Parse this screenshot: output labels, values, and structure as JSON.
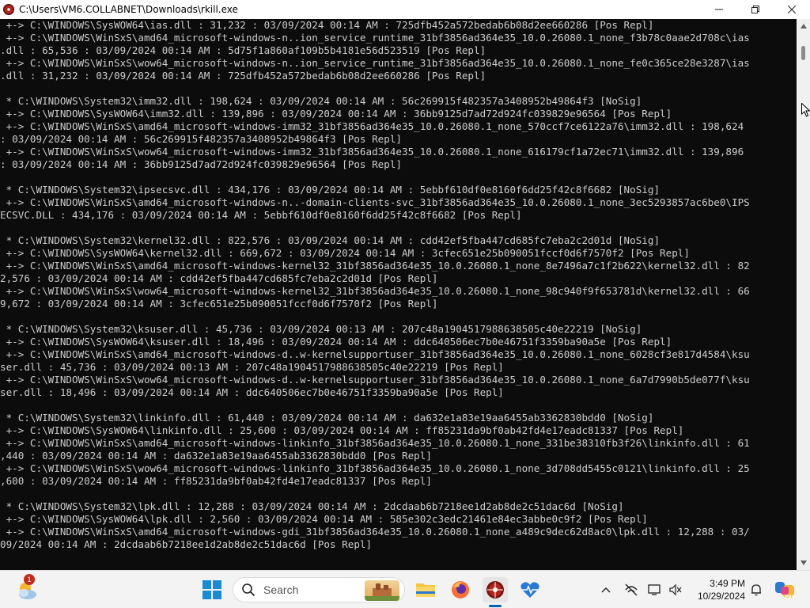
{
  "window": {
    "title": "C:\\Users\\VM6.COLLABNET\\Downloads\\rkill.exe"
  },
  "console": {
    "lines": [
      " +-> C:\\WINDOWS\\SysWOW64\\ias.dll : 31,232 : 03/09/2024 00:14 AM : 725dfb452a572bedab6b08d2ee660286 [Pos Repl]",
      " +-> C:\\WINDOWS\\WinSxS\\amd64_microsoft-windows-n..ion_service_runtime_31bf3856ad364e35_10.0.26080.1_none_f3b78c0aae2d708c\\ias",
      ".dll : 65,536 : 03/09/2024 00:14 AM : 5d75f1a860af109b5b4181e56d523519 [Pos Repl]",
      " +-> C:\\WINDOWS\\WinSxS\\wow64_microsoft-windows-n..ion_service_runtime_31bf3856ad364e35_10.0.26080.1_none_fe0c365ce28e3287\\ias",
      ".dll : 31,232 : 03/09/2024 00:14 AM : 725dfb452a572bedab6b08d2ee660286 [Pos Repl]",
      "",
      " * C:\\WINDOWS\\System32\\imm32.dll : 198,624 : 03/09/2024 00:14 AM : 56c269915f482357a3408952b49864f3 [NoSig]",
      " +-> C:\\WINDOWS\\SysWOW64\\imm32.dll : 139,896 : 03/09/2024 00:14 AM : 36bb9125d7ad72d924fc039829e96564 [Pos Repl]",
      " +-> C:\\WINDOWS\\WinSxS\\amd64_microsoft-windows-imm32_31bf3856ad364e35_10.0.26080.1_none_570ccf7ce6122a76\\imm32.dll : 198,624",
      ": 03/09/2024 00:14 AM : 56c269915f482357a3408952b49864f3 [Pos Repl]",
      " +-> C:\\WINDOWS\\WinSxS\\wow64_microsoft-windows-imm32_31bf3856ad364e35_10.0.26080.1_none_616179cf1a72ec71\\imm32.dll : 139,896",
      ": 03/09/2024 00:14 AM : 36bb9125d7ad72d924fc039829e96564 [Pos Repl]",
      "",
      " * C:\\WINDOWS\\System32\\ipsecsvc.dll : 434,176 : 03/09/2024 00:14 AM : 5ebbf610df0e8160f6dd25f42c8f6682 [NoSig]",
      " +-> C:\\WINDOWS\\WinSxS\\amd64_microsoft-windows-n..-domain-clients-svc_31bf3856ad364e35_10.0.26080.1_none_3ec5293857ac6be0\\IPS",
      "ECSVC.DLL : 434,176 : 03/09/2024 00:14 AM : 5ebbf610df0e8160f6dd25f42c8f6682 [Pos Repl]",
      "",
      " * C:\\WINDOWS\\System32\\kernel32.dll : 822,576 : 03/09/2024 00:14 AM : cdd42ef5fba447cd685fc7eba2c2d01d [NoSig]",
      " +-> C:\\WINDOWS\\SysWOW64\\kernel32.dll : 669,672 : 03/09/2024 00:14 AM : 3cfec651e25b090051fccf0d6f7570f2 [Pos Repl]",
      " +-> C:\\WINDOWS\\WinSxS\\amd64_microsoft-windows-kernel32_31bf3856ad364e35_10.0.26080.1_none_8e7496a7c1f2b622\\kernel32.dll : 82",
      "2,576 : 03/09/2024 00:14 AM : cdd42ef5fba447cd685fc7eba2c2d01d [Pos Repl]",
      " +-> C:\\WINDOWS\\WinSxS\\wow64_microsoft-windows-kernel32_31bf3856ad364e35_10.0.26080.1_none_98c940f9f653781d\\kernel32.dll : 66",
      "9,672 : 03/09/2024 00:14 AM : 3cfec651e25b090051fccf0d6f7570f2 [Pos Repl]",
      "",
      " * C:\\WINDOWS\\System32\\ksuser.dll : 45,736 : 03/09/2024 00:13 AM : 207c48a1904517988638505c40e22219 [NoSig]",
      " +-> C:\\WINDOWS\\SysWOW64\\ksuser.dll : 18,496 : 03/09/2024 00:14 AM : ddc640506ec7b0e46751f3359ba90a5e [Pos Repl]",
      " +-> C:\\WINDOWS\\WinSxS\\amd64_microsoft-windows-d..w-kernelsupportuser_31bf3856ad364e35_10.0.26080.1_none_6028cf3e817d4584\\ksu",
      "ser.dll : 45,736 : 03/09/2024 00:13 AM : 207c48a1904517988638505c40e22219 [Pos Repl]",
      " +-> C:\\WINDOWS\\WinSxS\\wow64_microsoft-windows-d..w-kernelsupportuser_31bf3856ad364e35_10.0.26080.1_none_6a7d7990b5de077f\\ksu",
      "ser.dll : 18,496 : 03/09/2024 00:14 AM : ddc640506ec7b0e46751f3359ba90a5e [Pos Repl]",
      "",
      " * C:\\WINDOWS\\System32\\linkinfo.dll : 61,440 : 03/09/2024 00:14 AM : da632e1a83e19aa6455ab3362830bdd0 [NoSig]",
      " +-> C:\\WINDOWS\\SysWOW64\\linkinfo.dll : 25,600 : 03/09/2024 00:14 AM : ff85231da9bf0ab42fd4e17eadc81337 [Pos Repl]",
      " +-> C:\\WINDOWS\\WinSxS\\amd64_microsoft-windows-linkinfo_31bf3856ad364e35_10.0.26080.1_none_331be38310fb3f26\\linkinfo.dll : 61",
      ",440 : 03/09/2024 00:14 AM : da632e1a83e19aa6455ab3362830bdd0 [Pos Repl]",
      " +-> C:\\WINDOWS\\WinSxS\\wow64_microsoft-windows-linkinfo_31bf3856ad364e35_10.0.26080.1_none_3d708dd5455c0121\\linkinfo.dll : 25",
      ",600 : 03/09/2024 00:14 AM : ff85231da9bf0ab42fd4e17eadc81337 [Pos Repl]",
      "",
      " * C:\\WINDOWS\\System32\\lpk.dll : 12,288 : 03/09/2024 00:14 AM : 2dcdaab6b7218ee1d2ab8de2c51dac6d [NoSig]",
      " +-> C:\\WINDOWS\\SysWOW64\\lpk.dll : 2,560 : 03/09/2024 00:14 AM : 585e302c3edc21461e84ec3abbe0c9f2 [Pos Repl]",
      " +-> C:\\WINDOWS\\WinSxS\\amd64_microsoft-windows-gdi_31bf3856ad364e35_10.0.26080.1_none_a489c9dec62d8ac0\\lpk.dll : 12,288 : 03/",
      "09/2024 00:14 AM : 2dcdaab6b7218ee1d2ab8de2c51dac6d [Pos Repl]"
    ]
  },
  "taskbar": {
    "notification_count": "1",
    "search_placeholder": "Search",
    "clock_time": "3:49 PM",
    "clock_date": "10/29/2024"
  }
}
